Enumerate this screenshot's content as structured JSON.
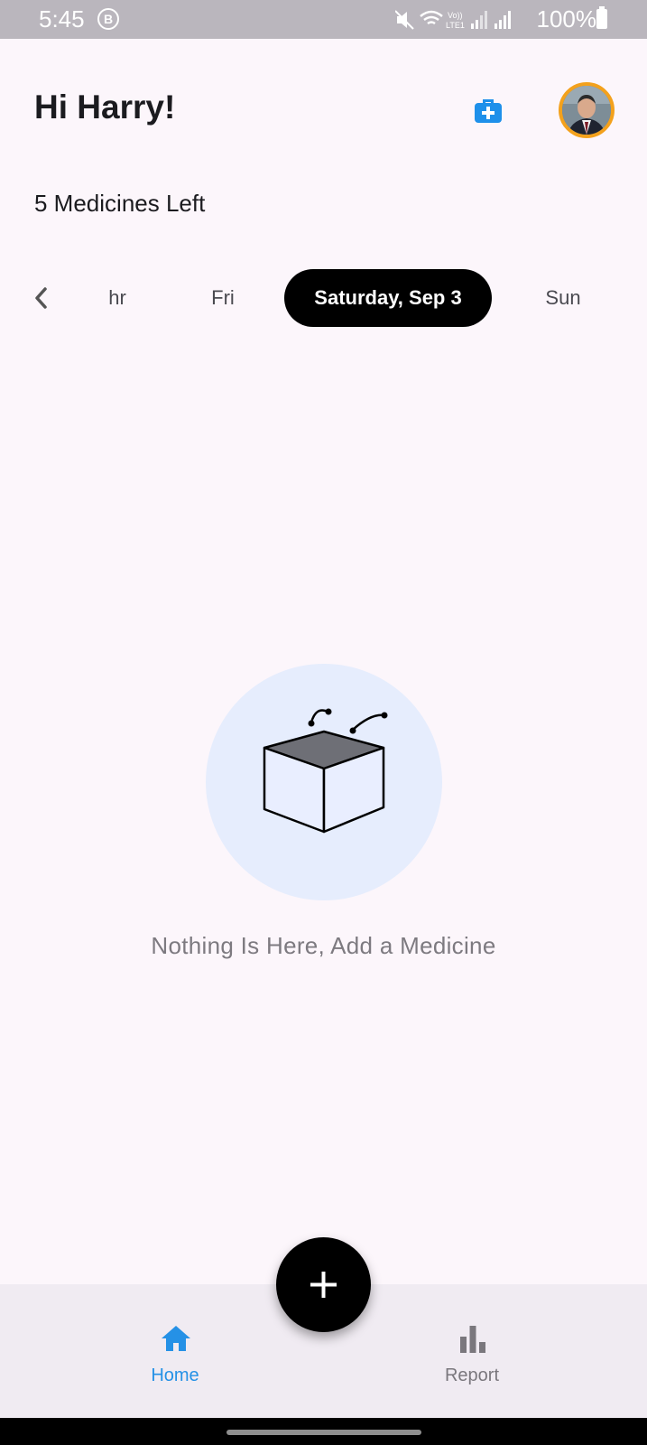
{
  "status_bar": {
    "time": "5:45",
    "b_badge": "B",
    "battery": "100%",
    "icons": [
      "mute-icon",
      "wifi-icon",
      "volte-icon",
      "signal-icon",
      "signal-icon",
      "battery-icon"
    ]
  },
  "header": {
    "greeting": "Hi Harry!",
    "kit_icon": "first-aid-kit-icon",
    "avatar": "user-avatar"
  },
  "summary": {
    "medicines_left": "5 Medicines Left"
  },
  "day_selector": {
    "days": [
      {
        "label": "hr",
        "selected": false
      },
      {
        "label": "Fri",
        "selected": false
      },
      {
        "label": "Saturday, Sep 3",
        "selected": true
      },
      {
        "label": "Sun",
        "selected": false
      }
    ]
  },
  "empty_state": {
    "message": "Nothing Is Here, Add a Medicine"
  },
  "bottom_nav": {
    "items": [
      {
        "label": "Home",
        "icon": "home-icon",
        "active": true
      },
      {
        "label": "Report",
        "icon": "bar-chart-icon",
        "active": false
      }
    ]
  },
  "fab": {
    "icon": "plus-icon"
  },
  "colors": {
    "accent": "#2591e6",
    "selected_day_bg": "#000000",
    "avatar_ring": "#f3a11c",
    "empty_circle": "#e6edfd",
    "background": "#fcf6fb"
  }
}
